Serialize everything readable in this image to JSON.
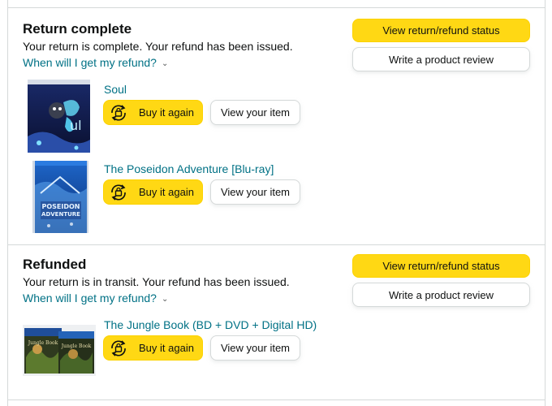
{
  "sections": [
    {
      "title": "Return complete",
      "desc": "Your return is complete. Your refund has been issued.",
      "link": "When will I get my refund?",
      "btn_status": "View return/refund status",
      "btn_review": "Write a product review",
      "items": [
        {
          "title": "Soul",
          "buy": "Buy it again",
          "view": "View your item",
          "image": "soul-dvd-cover"
        },
        {
          "title": "The Poseidon Adventure [Blu-ray]",
          "buy": "Buy it again",
          "view": "View your item",
          "image": "poseidon-bluray-cover"
        }
      ]
    },
    {
      "title": "Refunded",
      "desc": "Your return is in transit. Your refund has been issued.",
      "link": "When will I get my refund?",
      "btn_status": "View return/refund status",
      "btn_review": "Write a product review",
      "items": [
        {
          "title": "The Jungle Book (BD + DVD + Digital HD)",
          "buy": "Buy it again",
          "view": "View your item",
          "image": "jungle-book-bluray-cover"
        }
      ]
    }
  ],
  "icons": {
    "buy_again": "buy-again-icon",
    "chevron": "chevron-down-icon"
  },
  "colors": {
    "button_yellow": "#ffd814",
    "link_teal": "#007185",
    "border": "#d5d9d9"
  }
}
